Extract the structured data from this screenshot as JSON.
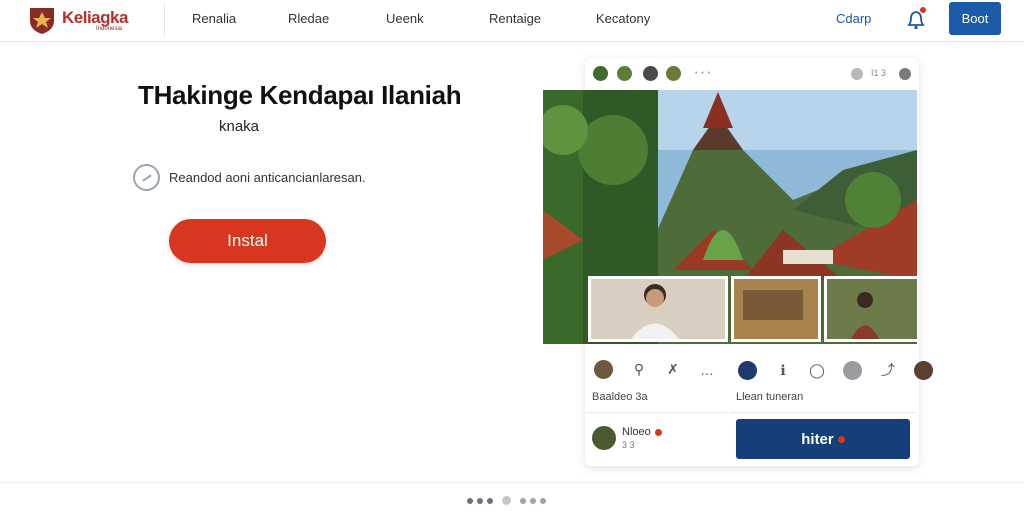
{
  "brand": {
    "name": "Keliagka",
    "tagline": "Indonesia"
  },
  "nav": {
    "items": [
      "Renalia",
      "Rledae",
      "Ueenk",
      "Rentaige",
      "Kecatony"
    ],
    "cta": "Cdarp",
    "button": "Boot"
  },
  "hero": {
    "title": "THakinge Kendapaı Ilaniah",
    "subtitle": "knaka",
    "checkbox_label": "Reandod aoni anticancianlaresan.",
    "install_label": "Instal"
  },
  "card": {
    "header_dots": "• • •",
    "header_right": "I1 3",
    "left_panel": {
      "label": "Baaldeo 3a",
      "user_name": "Nloeo",
      "user_meta": "3 3"
    },
    "right_panel": {
      "label": "Llean tuneran",
      "button_label": "hiter"
    }
  },
  "pager": {
    "count": 7,
    "active_index": 3
  },
  "colors": {
    "brand_red": "#b5302b",
    "install_red": "#d7371f",
    "primary_blue": "#1a5aa8",
    "dark_blue": "#143f7a"
  },
  "icons": [
    "logo-emblem",
    "bell-icon",
    "search-icon",
    "share-icon",
    "more-icon",
    "comment-icon",
    "bookmark-icon"
  ]
}
